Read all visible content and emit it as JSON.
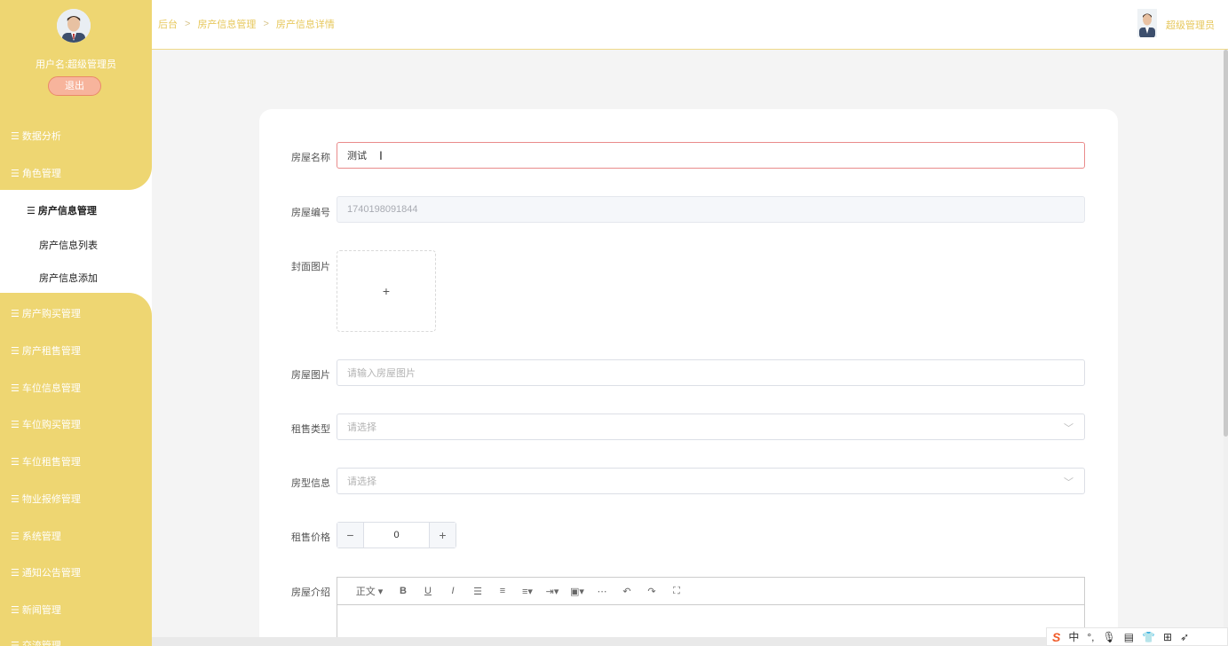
{
  "sidebar": {
    "username": "用户名:超级管理员",
    "logout": "退出",
    "menu": [
      {
        "label": "数据分析"
      },
      {
        "label": "角色管理"
      },
      {
        "label": "房产信息管理"
      },
      {
        "label": "房产购买管理"
      },
      {
        "label": "房产租售管理"
      },
      {
        "label": "车位信息管理"
      },
      {
        "label": "车位购买管理"
      },
      {
        "label": "车位租售管理"
      },
      {
        "label": "物业报修管理"
      },
      {
        "label": "系统管理"
      },
      {
        "label": "通知公告管理"
      },
      {
        "label": "新闻管理"
      },
      {
        "label": "交流管理"
      }
    ],
    "submenu": [
      "房产信息列表",
      "房产信息添加"
    ]
  },
  "header": {
    "breadcrumb": [
      "后台",
      "房产信息管理",
      "房产信息详情"
    ],
    "user": "超级管理员"
  },
  "form": {
    "name_label": "房屋名称",
    "name_value": "测试",
    "code_label": "房屋编号",
    "code_value": "1740198091844",
    "cover_label": "封面图片",
    "cover_plus": "+",
    "photo_label": "房屋图片",
    "photo_placeholder": "请输入房屋图片",
    "rent_type_label": "租售类型",
    "rent_type_placeholder": "请选择",
    "house_type_label": "房型信息",
    "house_type_placeholder": "请选择",
    "price_label": "租售价格",
    "price_value": "0",
    "intro_label": "房屋介绍"
  },
  "editor_toolbar": {
    "paragraph": "正文",
    "bold": "B",
    "underline": "U",
    "italic": "I"
  },
  "ime": {
    "lang": "中"
  },
  "colors": {
    "sidebar": "#eed672",
    "accent": "#e7c85d",
    "logout": "#f7b49c"
  }
}
